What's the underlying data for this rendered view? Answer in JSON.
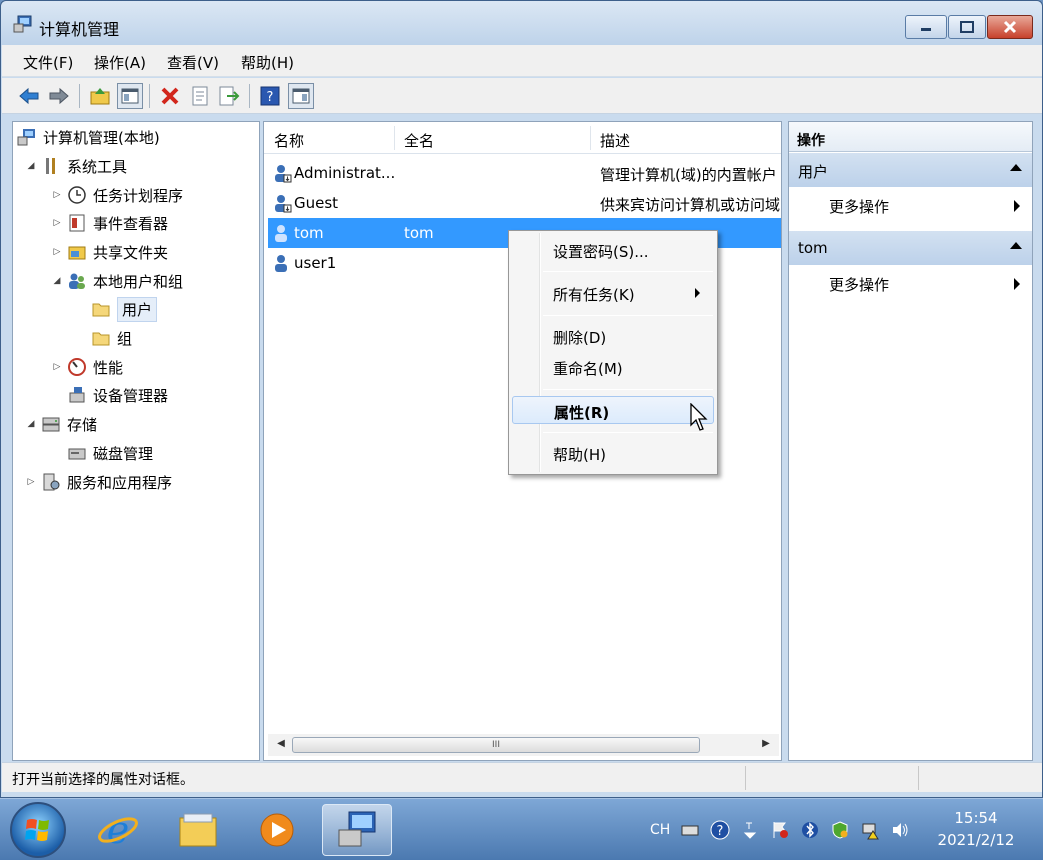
{
  "window": {
    "title": "计算机管理",
    "buttons": {
      "minimize": "minimize-button",
      "maximize": "maximize-button",
      "close": "close-button"
    }
  },
  "menubar": {
    "items": [
      "文件(F)",
      "操作(A)",
      "查看(V)",
      "帮助(H)"
    ]
  },
  "toolbar": {
    "icons": [
      "back-arrow-icon",
      "forward-arrow-icon",
      "up-folder-icon",
      "show-hide-tree-icon",
      "delete-icon",
      "properties-icon",
      "export-list-icon",
      "help-icon",
      "show-hide-action-pane-icon"
    ]
  },
  "tree": {
    "root": "计算机管理(本地)",
    "items": [
      {
        "label": "系统工具",
        "expanded": true
      },
      {
        "label": "任务计划程序",
        "expanded": false
      },
      {
        "label": "事件查看器",
        "expanded": false
      },
      {
        "label": "共享文件夹",
        "expanded": false
      },
      {
        "label": "本地用户和组",
        "expanded": true
      },
      {
        "label": "用户",
        "selected": true
      },
      {
        "label": "组"
      },
      {
        "label": "性能",
        "expanded": false
      },
      {
        "label": "设备管理器"
      },
      {
        "label": "存储",
        "expanded": true
      },
      {
        "label": "磁盘管理"
      },
      {
        "label": "服务和应用程序",
        "expanded": false
      }
    ]
  },
  "list": {
    "columns": [
      "名称",
      "全名",
      "描述"
    ],
    "rows": [
      {
        "name": "Administrat...",
        "fullname": "",
        "description": "管理计算机(域)的内置帐户"
      },
      {
        "name": "Guest",
        "fullname": "",
        "description": "供来宾访问计算机或访问域"
      },
      {
        "name": "tom",
        "fullname": "tom",
        "description": "",
        "selected": true
      },
      {
        "name": "user1",
        "fullname": "",
        "description": ""
      }
    ],
    "scroll_grip": "III"
  },
  "actions": {
    "header": "操作",
    "sections": [
      {
        "title": "用户",
        "item": "更多操作"
      },
      {
        "title": "tom",
        "item": "更多操作"
      }
    ]
  },
  "context_menu": {
    "items": [
      "设置密码(S)...",
      "所有任务(K)",
      "删除(D)",
      "重命名(M)",
      "属性(R)",
      "帮助(H)"
    ],
    "highlighted": "属性(R)"
  },
  "status": {
    "text": "打开当前选择的属性对话框。"
  },
  "taskbar": {
    "tray_lang": "CH",
    "time": "15:54",
    "date": "2021/2/12"
  },
  "colors": {
    "selection": "#3399ff",
    "window_frame": "#c9dbee",
    "taskbar": "#4b79b0"
  }
}
